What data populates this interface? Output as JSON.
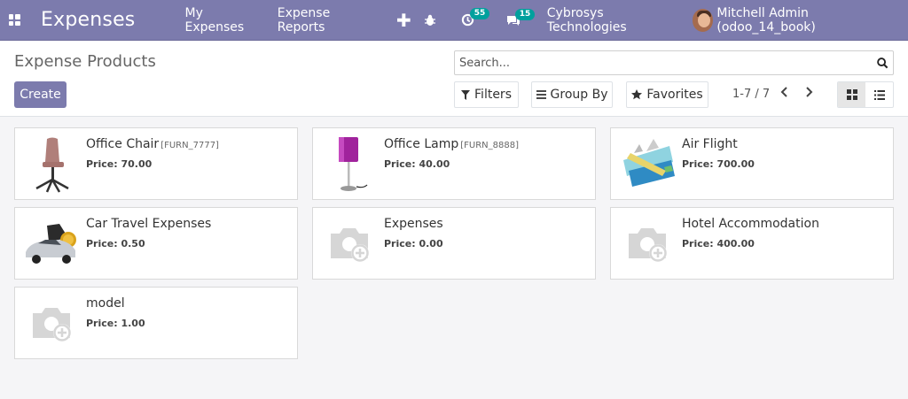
{
  "navbar": {
    "brand": "Expenses",
    "menu": [
      "My Expenses",
      "Expense Reports"
    ],
    "activity_count": "55",
    "message_count": "15",
    "company": "Cybrosys Technologies",
    "user": "Mitchell Admin (odoo_14_book)",
    "bg_color": "#7c7bad"
  },
  "control": {
    "title": "Expense Products",
    "create_label": "Create",
    "search_placeholder": "Search...",
    "filters_label": "Filters",
    "groupby_label": "Group By",
    "favorites_label": "Favorites",
    "pager": "1-7 / 7"
  },
  "products": [
    {
      "name": "Office Chair",
      "ref": "[FURN_7777]",
      "price": "Price: 70.00",
      "image": "chair"
    },
    {
      "name": "Office Lamp",
      "ref": "[FURN_8888]",
      "price": "Price: 40.00",
      "image": "lamp"
    },
    {
      "name": "Air Flight",
      "ref": "",
      "price": "Price: 700.00",
      "image": "flight"
    },
    {
      "name": "Car Travel Expenses",
      "ref": "",
      "price": "Price: 0.50",
      "image": "car"
    },
    {
      "name": "Expenses",
      "ref": "",
      "price": "Price: 0.00",
      "image": "placeholder-camera"
    },
    {
      "name": "Hotel Accommodation",
      "ref": "",
      "price": "Price: 400.00",
      "image": "placeholder-camera"
    },
    {
      "name": "model",
      "ref": "",
      "price": "Price: 1.00",
      "image": "placeholder-camera"
    }
  ]
}
